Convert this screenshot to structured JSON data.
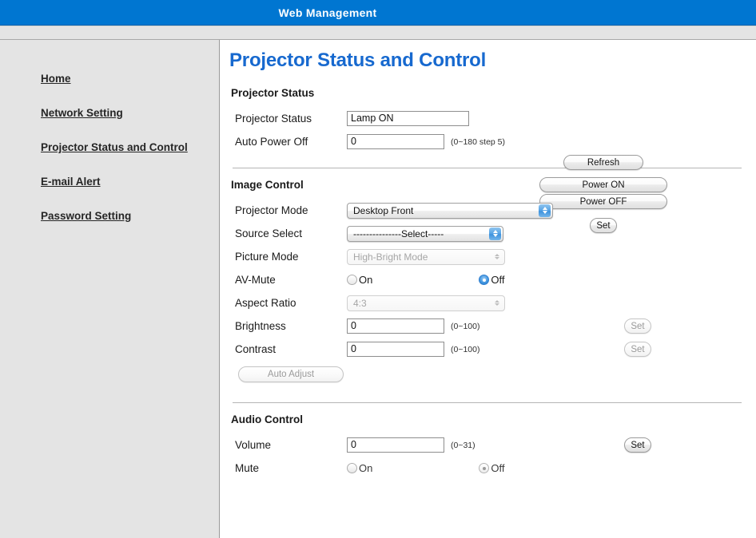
{
  "header": {
    "title": "Web Management"
  },
  "sidebar": {
    "items": [
      {
        "label": "Home",
        "name": "home"
      },
      {
        "label": "Network Setting",
        "name": "network-setting"
      },
      {
        "label": "Projector Status and Control",
        "name": "projector-status-and-control"
      },
      {
        "label": "E-mail Alert",
        "name": "email-alert"
      },
      {
        "label": "Password Setting",
        "name": "password-setting"
      }
    ]
  },
  "main": {
    "page_title": "Projector Status and Control",
    "projector_status": {
      "heading": "Projector Status",
      "status_label": "Projector Status",
      "status_value": "Lamp ON",
      "auto_power_off_label": "Auto Power Off",
      "auto_power_off_value": "0",
      "auto_power_off_hint": "(0~180 step 5)",
      "refresh_button": "Refresh",
      "power_on_button": "Power ON",
      "power_off_button": "Power OFF",
      "set_button": "Set"
    },
    "image_control": {
      "heading": "Image Control",
      "projector_mode_label": "Projector Mode",
      "projector_mode_value": "Desktop Front",
      "source_select_label": "Source Select",
      "source_select_value": "---------------Select-----",
      "picture_mode_label": "Picture Mode",
      "picture_mode_value": "High-Bright Mode",
      "av_mute_label": "AV-Mute",
      "av_mute_on": "On",
      "av_mute_off": "Off",
      "av_mute_selected": "Off",
      "aspect_ratio_label": "Aspect Ratio",
      "aspect_ratio_value": "4:3",
      "brightness_label": "Brightness",
      "brightness_value": "0",
      "brightness_hint": "(0~100)",
      "brightness_set_button": "Set",
      "contrast_label": "Contrast",
      "contrast_value": "0",
      "contrast_hint": "(0~100)",
      "contrast_set_button": "Set",
      "auto_adjust_button": "Auto Adjust"
    },
    "audio_control": {
      "heading": "Audio Control",
      "volume_label": "Volume",
      "volume_value": "0",
      "volume_hint": "(0~31)",
      "volume_set_button": "Set",
      "mute_label": "Mute",
      "mute_on": "On",
      "mute_off": "Off",
      "mute_selected": "Off"
    }
  },
  "colors": {
    "header_blue": "#0076d1",
    "title_blue": "#1769cf",
    "sidebar_gray": "#e4e4e4",
    "aqua_blue": "#3e94df"
  }
}
